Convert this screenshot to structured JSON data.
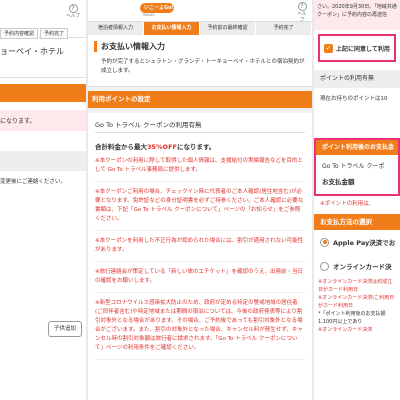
{
  "left": {
    "tabs": [
      "予約内容確認",
      "予約完了"
    ],
    "help_label": "ヘルプ",
    "hotel_name": "ョーペイ・ホテル",
    "pink_text": "になります。",
    "text1": "変更後にご連絡ください。",
    "child_button": "子供追加"
  },
  "mid": {
    "logo_text": "いこーよGo!",
    "logo_sub": "TRAVEL",
    "help_label": "ヘルプ",
    "steps": [
      "宿泊者情報入力",
      "お支払い情報入力",
      "予約前の最終確認",
      "予約完了"
    ],
    "title": "お支払い情報入力",
    "intro": "予約が完了するとシェラトン・グランデ・トーキョーベイ・ホテルとの宿泊契約が成立します。",
    "points_section": "利用ポイントの設定",
    "coupon_heading": "Go To トラベル クーポンの利用有無",
    "total_text_prefix": "合計料金から最大",
    "total_text_percent": "35%OFF",
    "total_text_suffix": "になります。",
    "notes": [
      "※本クーポンの利用に際して取得した個人情報は、支援給付の実績報告などを目的として Go To トラベル事務局に提供します。",
      "※本クーポンご利用の場合、チェックイン時に代表者のご本人確認(居住地含む)が必要となります。免許証などの身分証明書を必ずご持参ください。ご本人確認に必要な書類は、下記「Go To トラベル クーポンについて」ページの「お知らせ」をご参照ください。",
      "※本クーポンを利用した不正行為が認められた場合には、割引が適用されない可能性があります。",
      "※旅行連絡会が策定している「新しい旅のエチケット」を確認のうえ、出発前・当日の確認をお願いします。",
      "※新型コロナウイルス感染拡大防止のため、政府が定める特定の警戒地域の居住者(ご同伴者含む)や特定地域または期間の宿泊については、今後の政府発表等により割引対象外となる場合があります。その場合、ご予約後であっても割引対象外となる場合がございます。また、割引の対象外となった場合、キャンセル料が発生せず、キャンセル時の割引対象額は旅行者に請求されます。「Go To トラベル クーポンについて」ページの利用条件をご確認ください。"
    ]
  },
  "right": {
    "pink_text": "さい。2020年9月30日、「地域共通クーポン」に予約内容の再送信",
    "agree_label": "上記に同意して利用",
    "point_usage_header": "ポイントの利用有無",
    "points_text": "現在お持ちのポイントは10",
    "point_apply_header": "ポイント利用後のお支払金額",
    "coupon_row": "Go To トラベル クーポ",
    "payment_amount": "お支払金額",
    "note_red": "※ポイントの利用は、",
    "payment_method_header": "お支払方法の選択",
    "apple_pay": "Apple Pay決済でお",
    "online_card": "オンラインカード決",
    "notes": [
      "※オンラインカード決済は約成立日がカード利用日",
      "※オンラインカード決済(こ利用日がカード利用日",
      "*「ポイント利用後のお支払額1,100円以上であり",
      "※オンラインカード決済"
    ]
  },
  "colors": {
    "orange": "#f07d1a",
    "pink_highlight": "#e73278",
    "red_text": "#e0312b"
  }
}
